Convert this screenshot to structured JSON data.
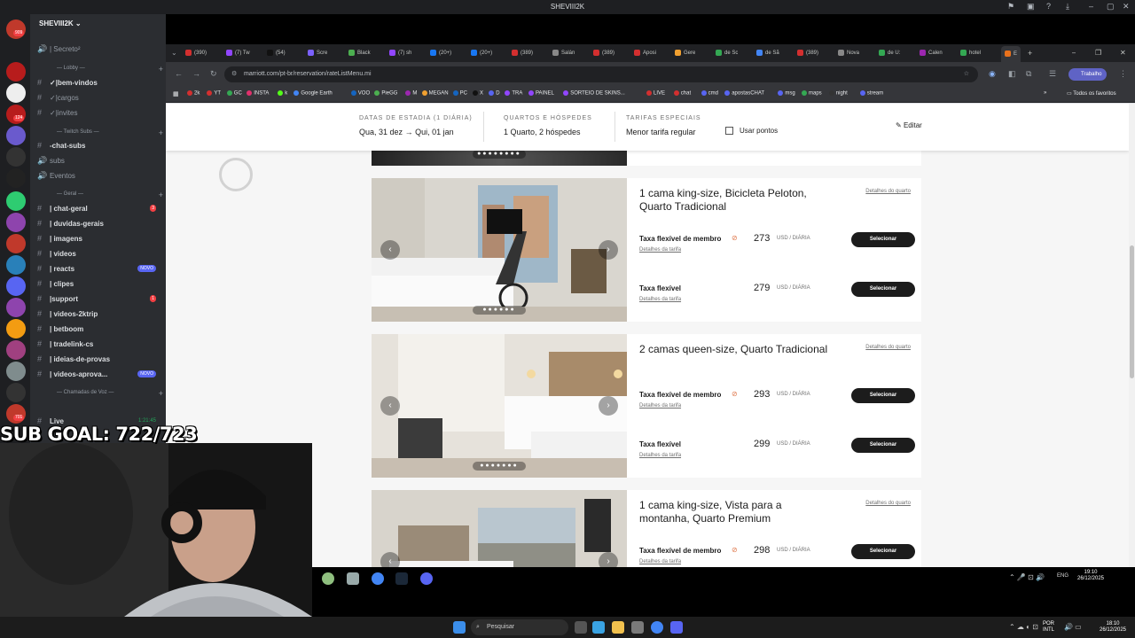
{
  "window_title": "SHEVIII2K",
  "discord": {
    "server_name": "SHEVIII2K",
    "server_badges": [
      "909",
      "",
      "",
      "",
      "124",
      "",
      "",
      "",
      "",
      "",
      "",
      "",
      "",
      "",
      "",
      "",
      "",
      "",
      "",
      "",
      "",
      "",
      "",
      "",
      "",
      "701"
    ],
    "top_channels": [
      {
        "name": "| Secreto²"
      }
    ],
    "categories": {
      "lobby": "Lobby",
      "twitch": "Twitch Subs",
      "geral": "Geral",
      "voz": "Chamadas de Voz"
    },
    "lobby_channels": [
      {
        "name": "✓|bem-vindos"
      },
      {
        "name": "✓|cargos"
      },
      {
        "name": "✓|invites"
      }
    ],
    "twitch_channels": [
      {
        "name": "-chat-subs"
      },
      {
        "name": "subs"
      },
      {
        "name": "Eventos"
      }
    ],
    "geral_channels": [
      {
        "name": "| chat-geral",
        "badge": "3"
      },
      {
        "name": "| duvidas-gerais",
        "badge": ""
      },
      {
        "name": "| imagens",
        "badge": ""
      },
      {
        "name": "| videos",
        "badge": ""
      },
      {
        "name": "| reacts",
        "badge": "NOVO"
      },
      {
        "name": "| clipes",
        "badge": ""
      },
      {
        "name": "|support",
        "badge": "1"
      },
      {
        "name": "| videos-2ktrip",
        "badge": ""
      },
      {
        "name": "| betboom",
        "badge": ""
      },
      {
        "name": "| tradelink-cs",
        "badge": ""
      },
      {
        "name": "| ideias-de-provas",
        "badge": ""
      },
      {
        "name": "| videos-aprova...",
        "badge": "NOVO"
      }
    ],
    "voice_channel": {
      "name": "Live",
      "time": "1:21:45"
    }
  },
  "overlay": {
    "sub_goal": "SUB GOAL: 722/723"
  },
  "browser": {
    "tabs": [
      "(390)",
      "(7) Tw",
      "(54)",
      "Scre",
      "Black",
      "(7) sh",
      "(20+)",
      "(20+)",
      "(389)",
      "Salán",
      "(389)",
      "Aposi",
      "Gere",
      "de Sc",
      "de Sã",
      "(389)",
      "Nova",
      "de U:",
      "Calen",
      "hotel",
      "E"
    ],
    "url": "marriott.com/pt-br/reservation/rateListMenu.mi",
    "profile": "Trabalho",
    "bookmarks": [
      "2k",
      "YT",
      "GC",
      "INSTA",
      "k",
      "Google Earth",
      "VOO",
      "PieGG",
      "M",
      "MEGAN",
      "PC",
      "X",
      "D",
      "TRA",
      "PAINEL",
      "SORTEIO DE SKINS...",
      "LIVE",
      "chat",
      "cmd",
      "apostasCHAT",
      "msg",
      "maps",
      "night",
      "stream"
    ],
    "bookmarks_folder": "Todos os favoritos"
  },
  "search": {
    "dates_label": "DATAS DE ESTADIA (1 DIÁRIA)",
    "check_in": "Qua, 31 dez",
    "arrow": "→",
    "check_out": "Qui, 01 jan",
    "rooms_label": "QUARTOS E HÓSPEDES",
    "rooms_value": "1 Quarto, 2 hóspedes",
    "rates_label": "TARIFAS ESPECIAIS",
    "rates_value": "Menor tarifa regular",
    "points_label": "Usar pontos",
    "edit_label": "Editar"
  },
  "rooms": [
    {
      "title": "1 cama king-size, Bicicleta Peloton, Quarto Tradicional",
      "details": "Detalhes do quarto",
      "rates": [
        {
          "name": "Taxa flexível de membro",
          "sub": "Detalhes da tarifa",
          "price": "273",
          "unit": "USD / DIÁRIA",
          "button": "Selecionar"
        },
        {
          "name": "Taxa flexível",
          "sub": "Detalhes da tarifa",
          "price": "279",
          "unit": "USD / DIÁRIA",
          "button": "Selecionar"
        }
      ]
    },
    {
      "title": "2 camas queen-size, Quarto Tradicional",
      "details": "Detalhes do quarto",
      "rates": [
        {
          "name": "Taxa flexível de membro",
          "sub": "Detalhes da tarifa",
          "price": "293",
          "unit": "USD / DIÁRIA",
          "button": "Selecionar"
        },
        {
          "name": "Taxa flexível",
          "sub": "Detalhes da tarifa",
          "price": "299",
          "unit": "USD / DIÁRIA",
          "button": "Selecionar"
        }
      ]
    },
    {
      "title": "1 cama king-size, Vista para a montanha, Quarto Premium",
      "details": "Detalhes do quarto",
      "rates": [
        {
          "name": "Taxa flexível de membro",
          "sub": "Detalhes da tarifa",
          "price": "298",
          "unit": "USD / DIÁRIA",
          "button": "Selecionar"
        }
      ]
    }
  ],
  "taskbar": {
    "search_placeholder": "Pesquisar",
    "lang": "POR",
    "layout": "INTL",
    "eng": "ENG",
    "time": "19:10",
    "date": "26/12/2025",
    "time2": "18:10",
    "date2": "26/12/2025"
  }
}
